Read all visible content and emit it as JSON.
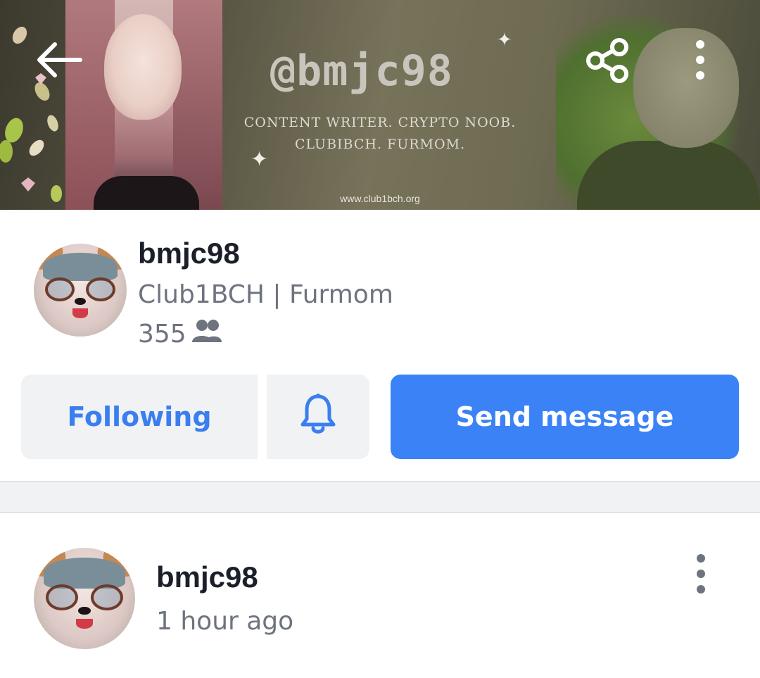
{
  "banner": {
    "handle": "@bmjc98",
    "tagline_line1": "CONTENT WRITER. CRYPTO NOOB.",
    "tagline_line2": "CLUBIBCH. FURMOM.",
    "url": "www.club1bch.org"
  },
  "icons": {
    "back": "back-arrow-icon",
    "share": "share-icon",
    "more": "more-vertical-icon",
    "followers": "people-icon",
    "bell": "bell-icon"
  },
  "profile": {
    "name": "bmjc98",
    "bio": "Club1BCH | Furmom",
    "follower_count": "355"
  },
  "actions": {
    "following_label": "Following",
    "send_message_label": "Send message"
  },
  "post": {
    "author": "bmjc98",
    "time": "1 hour ago"
  },
  "colors": {
    "accent": "#3b82f6",
    "following_text": "#3a7ef0",
    "button_bg": "#f1f2f4"
  }
}
